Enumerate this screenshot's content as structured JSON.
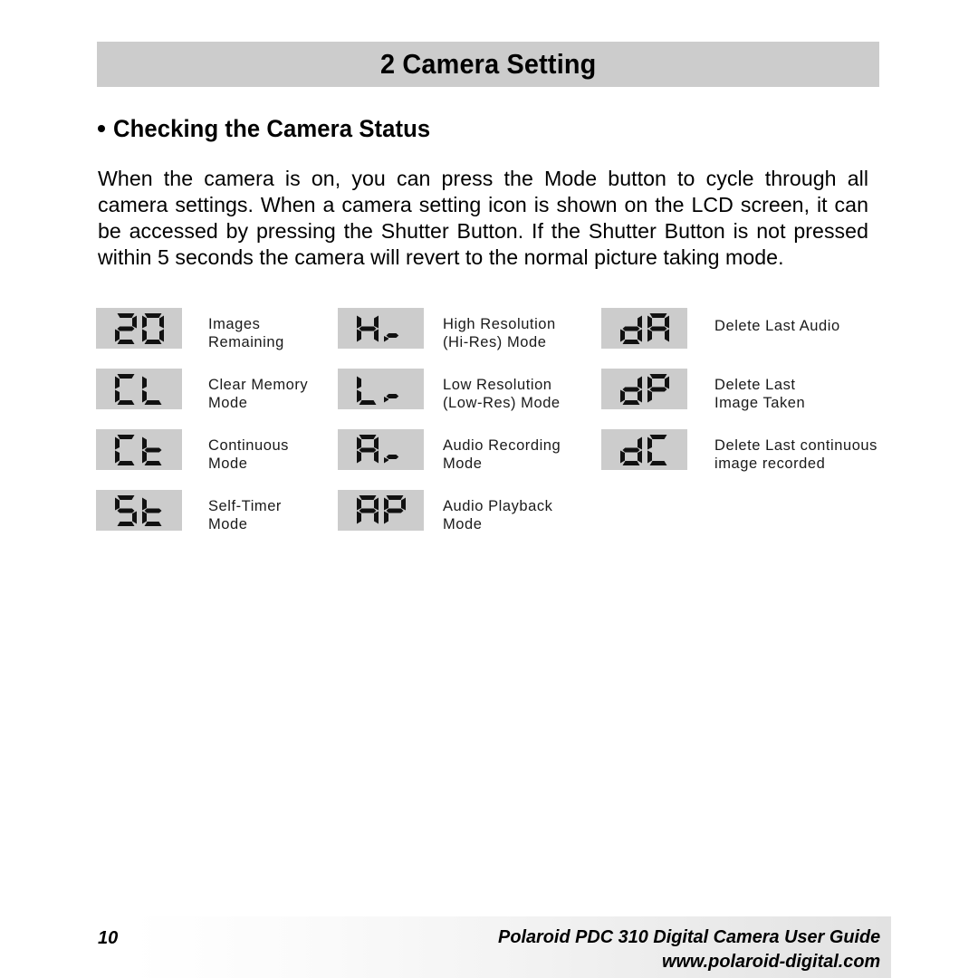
{
  "chapter": {
    "title": "2 Camera Setting",
    "band_color": "#cccccc"
  },
  "section": {
    "bullet": "bullet-dot",
    "heading": "Checking the Camera Status",
    "body": "When the camera is on, you can press the Mode button to cycle through all camera settings.  When a camera setting icon is shown on the LCD screen,  it can be accessed by pressing the Shutter Button. If the Shutter Button is not pressed within 5 seconds the camera will revert to the normal picture taking mode."
  },
  "status_icons": {
    "box_color": "#cccccc",
    "rows": [
      {
        "col1": {
          "code": "20",
          "label": "Images\nRemaining",
          "lines": 2
        },
        "col2": {
          "code": "Hr",
          "label": "High Resolution\n(Hi-Res) Mode",
          "lines": 2
        },
        "col3": {
          "code": "dA",
          "label": "Delete Last Audio",
          "lines": 1
        }
      },
      {
        "col1": {
          "code": "CL",
          "label": "Clear Memory\nMode",
          "lines": 2
        },
        "col2": {
          "code": "Lr",
          "label": "Low Resolution\n(Low-Res) Mode",
          "lines": 2
        },
        "col3": {
          "code": "dP",
          "label": "Delete Last\nImage Taken",
          "lines": 2
        }
      },
      {
        "col1": {
          "code": "Ct",
          "label": "Continuous\nMode",
          "lines": 2
        },
        "col2": {
          "code": "Ar",
          "label": "Audio Recording\nMode",
          "lines": 2
        },
        "col3": {
          "code": "dC",
          "label": "Delete Last continuous\nimage recorded",
          "lines": 2
        }
      },
      {
        "col1": {
          "code": "St",
          "label": "Self-Timer\nMode",
          "lines": 2
        },
        "col2": {
          "code": "AP",
          "label": "Audio Playback\nMode",
          "lines": 2
        },
        "col3": null
      }
    ]
  },
  "footer": {
    "page_number": "10",
    "product_line": "Polaroid PDC 310 Digital Camera User Guide",
    "website": "www.polaroid-digital.com"
  }
}
